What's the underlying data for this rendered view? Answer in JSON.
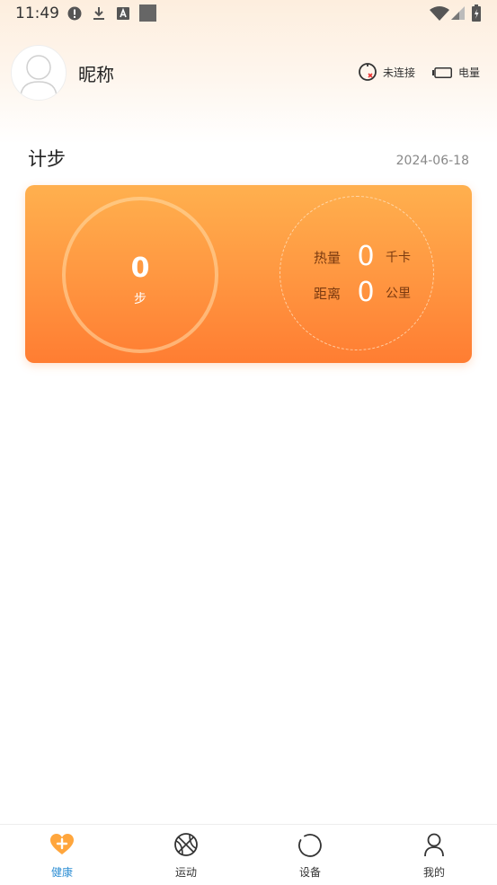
{
  "status_bar": {
    "time": "11:49"
  },
  "header": {
    "nickname": "昵称",
    "connection_status": "未连接",
    "battery_label": "电量"
  },
  "section": {
    "title": "计步",
    "date": "2024-06-18"
  },
  "step_card": {
    "steps_value": "0",
    "steps_unit": "步",
    "calories": {
      "label": "热量",
      "value": "0",
      "unit": "千卡"
    },
    "distance": {
      "label": "距离",
      "value": "0",
      "unit": "公里"
    }
  },
  "tab_bar": {
    "tabs": [
      {
        "label": "健康",
        "icon": "health-icon",
        "active": true
      },
      {
        "label": "运动",
        "icon": "basketball-icon",
        "active": false
      },
      {
        "label": "设备",
        "icon": "device-icon",
        "active": false
      },
      {
        "label": "我的",
        "icon": "profile-icon",
        "active": false
      }
    ]
  },
  "colors": {
    "accent": "#2f8fd4",
    "card_top": "#ffb04e",
    "card_bottom": "#ff7d32"
  }
}
